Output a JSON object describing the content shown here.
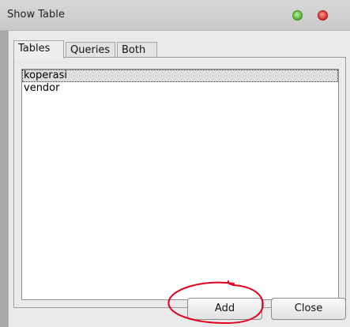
{
  "window": {
    "title": "Show Table"
  },
  "tabs": [
    {
      "label": "Tables",
      "active": true
    },
    {
      "label": "Queries",
      "active": false
    },
    {
      "label": "Both",
      "active": false
    }
  ],
  "list": {
    "items": [
      {
        "label": "koperasi",
        "selected": true
      },
      {
        "label": "vendor",
        "selected": false
      }
    ]
  },
  "buttons": {
    "add_label": "Add",
    "close_label": "Close"
  },
  "colors": {
    "titlebar": "#cfcfcf",
    "dialog_bg": "#eaeaea",
    "annotation": "#e0001b",
    "traffic_green": "#4fae2d",
    "traffic_red": "#d12a2a"
  },
  "icons": [
    "maximize-icon",
    "close-window-icon"
  ]
}
